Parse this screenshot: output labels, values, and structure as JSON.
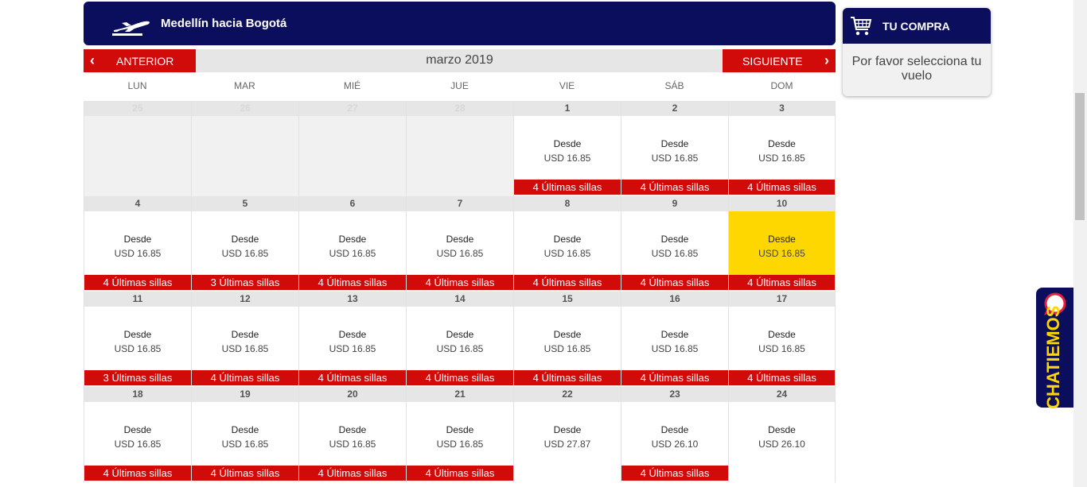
{
  "route": {
    "title": "Medellín hacia Bogotá",
    "icon": "plane-takeoff-icon"
  },
  "nav": {
    "prev_label": "ANTERIOR",
    "next_label": "SIGUIENTE",
    "month": "marzo 2019"
  },
  "weekdays": [
    "LUN",
    "MAR",
    "MIÉ",
    "JUE",
    "VIE",
    "SÁB",
    "DOM"
  ],
  "days": [
    {
      "num": "25",
      "empty": true
    },
    {
      "num": "26",
      "empty": true
    },
    {
      "num": "27",
      "empty": true
    },
    {
      "num": "28",
      "empty": true
    },
    {
      "num": "1",
      "desde": "Desde",
      "price": "USD 16.85",
      "seats": "4 Últimas sillas"
    },
    {
      "num": "2",
      "desde": "Desde",
      "price": "USD 16.85",
      "seats": "4 Últimas sillas"
    },
    {
      "num": "3",
      "desde": "Desde",
      "price": "USD 16.85",
      "seats": "4 Últimas sillas"
    },
    {
      "num": "4",
      "desde": "Desde",
      "price": "USD 16.85",
      "seats": "4 Últimas sillas"
    },
    {
      "num": "5",
      "desde": "Desde",
      "price": "USD 16.85",
      "seats": "3 Últimas sillas"
    },
    {
      "num": "6",
      "desde": "Desde",
      "price": "USD 16.85",
      "seats": "4 Últimas sillas"
    },
    {
      "num": "7",
      "desde": "Desde",
      "price": "USD 16.85",
      "seats": "4 Últimas sillas"
    },
    {
      "num": "8",
      "desde": "Desde",
      "price": "USD 16.85",
      "seats": "4 Últimas sillas"
    },
    {
      "num": "9",
      "desde": "Desde",
      "price": "USD 16.85",
      "seats": "4 Últimas sillas"
    },
    {
      "num": "10",
      "desde": "Desde",
      "price": "USD 16.85",
      "seats": "4 Últimas sillas",
      "selected": true
    },
    {
      "num": "11",
      "desde": "Desde",
      "price": "USD 16.85",
      "seats": "3 Últimas sillas"
    },
    {
      "num": "12",
      "desde": "Desde",
      "price": "USD 16.85",
      "seats": "4 Últimas sillas"
    },
    {
      "num": "13",
      "desde": "Desde",
      "price": "USD 16.85",
      "seats": "4 Últimas sillas"
    },
    {
      "num": "14",
      "desde": "Desde",
      "price": "USD 16.85",
      "seats": "4 Últimas sillas"
    },
    {
      "num": "15",
      "desde": "Desde",
      "price": "USD 16.85",
      "seats": "4 Últimas sillas"
    },
    {
      "num": "16",
      "desde": "Desde",
      "price": "USD 16.85",
      "seats": "4 Últimas sillas"
    },
    {
      "num": "17",
      "desde": "Desde",
      "price": "USD 16.85",
      "seats": "4 Últimas sillas"
    },
    {
      "num": "18",
      "desde": "Desde",
      "price": "USD 16.85",
      "seats": "4 Últimas sillas"
    },
    {
      "num": "19",
      "desde": "Desde",
      "price": "USD 16.85",
      "seats": "4 Últimas sillas"
    },
    {
      "num": "20",
      "desde": "Desde",
      "price": "USD 16.85",
      "seats": "4 Últimas sillas"
    },
    {
      "num": "21",
      "desde": "Desde",
      "price": "USD 16.85",
      "seats": "4 Últimas sillas"
    },
    {
      "num": "22",
      "desde": "Desde",
      "price": "USD 27.87",
      "seats": ""
    },
    {
      "num": "23",
      "desde": "Desde",
      "price": "USD 26.10",
      "seats": "4 Últimas sillas"
    },
    {
      "num": "24",
      "desde": "Desde",
      "price": "USD 26.10",
      "seats": ""
    }
  ],
  "cart": {
    "title": "TU COMPRA",
    "message": "Por favor selecciona tu vuelo",
    "icon": "shopping-cart-icon"
  },
  "chat": {
    "label": "CHATIEMOS",
    "icon": "chat-bubble-icon"
  },
  "colors": {
    "navy": "#0b0e5c",
    "red": "#d10a0a",
    "selected": "#ffd700"
  }
}
